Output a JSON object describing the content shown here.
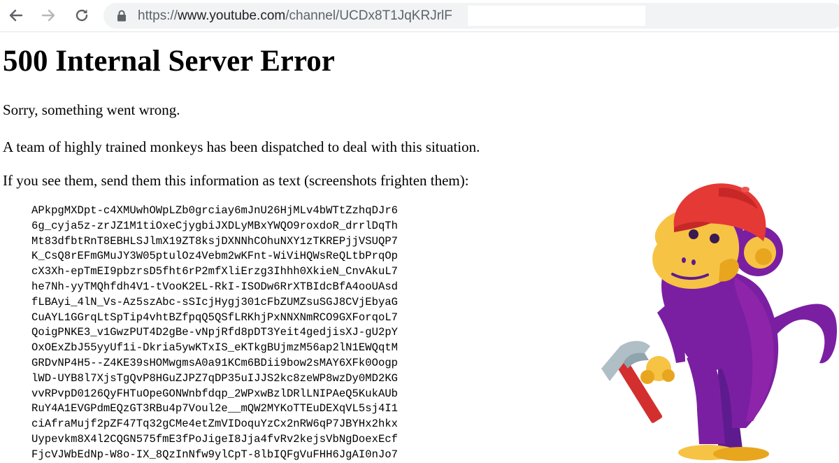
{
  "browser": {
    "url": {
      "scheme": "https://",
      "host": "www.youtube.com",
      "path": "/channel/UCDx8T1JqKRJrlF"
    }
  },
  "page": {
    "heading": "500 Internal Server Error",
    "paragraphs": [
      "Sorry, something went wrong.",
      "A team of highly trained monkeys has been dispatched to deal with this situation.",
      "If you see them, send them this information as text (screenshots frighten them):"
    ],
    "error_code_lines": [
      "APkpgMXDpt-c4XMUwhOWpLZb0grciay6mJnU26HjMLv4bWTtZzhqDJr6",
      "6g_cyja5z-zrJZ1M1tiOxeCjygbiJXDLyMBxYWQO9roxdoR_drrlDqTh",
      "Mt83dfbtRnT8EBHLSJlmX19ZT8ksjDXNNhCOhuNXY1zTKREPjjVSUQP7",
      "K_CsQ8rEFmGMuJY3W05ptulOz4Vebm2wKFnt-WiViHQWsReQLtbPrqOp",
      "cX3Xh-epTmEI9pbzrsD5fht6rP2mfXliErzg3Ihhh0XkieN_CnvAkuL7",
      "he7Nh-yyTMQhfdh4V1-tVooK2EL-RkI-ISODw6RrXTBIdcBfA4ooUAsd",
      "fLBAyi_4lN_Vs-Az5szAbc-sSIcjHygj301cFbZUMZsuSGJ8CVjEbyaG",
      "CuAYL1GGrqLtSpTip4vhtBZfpqQ5QSfLRKhjPxNNXNmRCO9GXForqoL7",
      "QoigPNKE3_v1GwzPUT4D2gBe-vNpjRfd8pDT3Yeit4gedjisXJ-gU2pY",
      "OxOExZbJ55yyUf1i-Dkria5ywKTxIS_eKTkgBUjmzM56ap2lN1EWQqtM",
      "GRDvNP4H5--Z4KE39sHOMwgmsA0a91KCm6BDii9bow2sMAY6XFk0Oogp",
      "lWD-UYB8l7XjsTgQvP8HGuZJPZ7qDP35uIJJS2kc8zeWP8wzDy0MD2KG",
      "vvRPvpD0126QyFHTuOpeGONWnbfdqp_2WPxwBzlDRlLNIPAeQ5KukAUb",
      "RuY4A1EVGPdmEQzGT3RBu4p7Voul2e__mQW2MYKoTTEuDEXqVL5sj4I1",
      "ciAfraMujf2pZF47Tq32gCMe4etZmVIDoquYzCx2nRW6qP7JBYHx2hkx",
      "Uypevkm8X4l2CQGN575fmE3fPoJigeI8Jja4fvRv2kejsVbNgDoexEcf",
      "FjcVJWbEdNp-W8o-IX_8QzInNfw9ylCpT-8lbIQFgVuFHH6JgAI0nJo7"
    ]
  },
  "colors": {
    "monkey_purple": "#7b1fa2",
    "monkey_purple_dark": "#5e1b8f",
    "monkey_face": "#f6c344",
    "monkey_face_shadow": "#e8a51e",
    "cap_red": "#e53935",
    "hammer_handle": "#d32f2f",
    "hammer_head": "#b0bec5"
  }
}
